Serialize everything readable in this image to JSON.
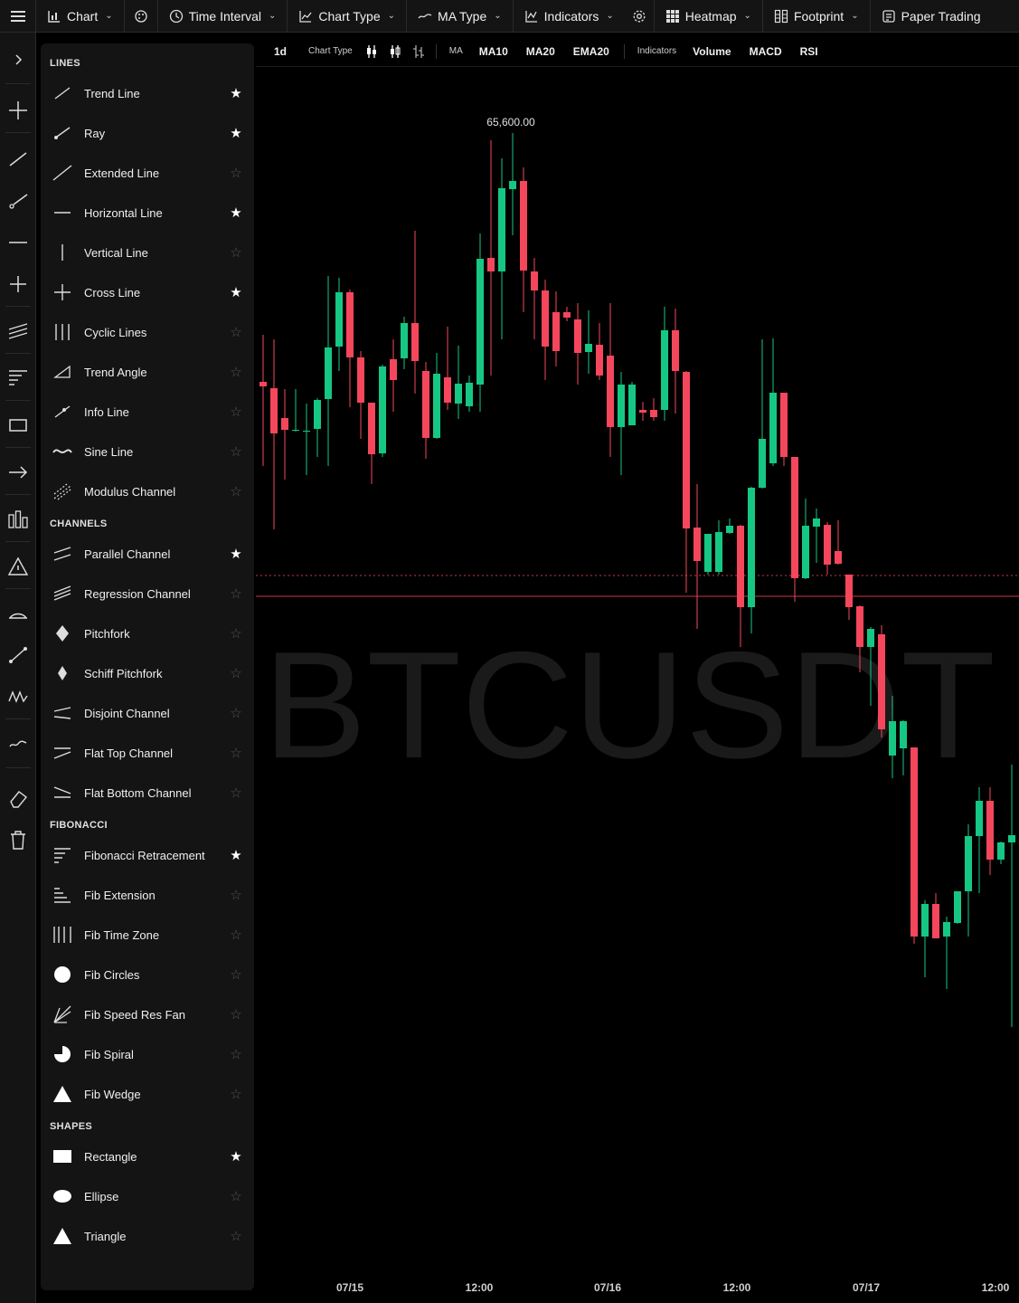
{
  "topbar": {
    "items": [
      {
        "label": "Chart",
        "icon": "bar-chart-icon",
        "dropdown": true
      },
      {
        "label": "",
        "icon": "palette-icon",
        "dropdown": false
      },
      {
        "label": "Time Interval",
        "icon": "clock-icon",
        "dropdown": true
      },
      {
        "label": "Chart Type",
        "icon": "line-chart-icon",
        "dropdown": true
      },
      {
        "label": "MA Type",
        "icon": "wave-icon",
        "dropdown": true
      },
      {
        "label": "Indicators",
        "icon": "indicators-icon",
        "dropdown": true
      },
      {
        "label": "",
        "icon": "gear-icon",
        "dropdown": false
      },
      {
        "label": "Heatmap",
        "icon": "grid-icon",
        "dropdown": true
      },
      {
        "label": "Footprint",
        "icon": "footprint-icon",
        "dropdown": true
      },
      {
        "label": "Paper Trading",
        "icon": "paper-icon",
        "dropdown": false
      }
    ]
  },
  "subbar": {
    "interval": "1d",
    "chart_type_label": "Chart Type",
    "ma_label": "MA",
    "ma_items": [
      "MA10",
      "MA20",
      "EMA20"
    ],
    "indicators_label": "Indicators",
    "indicator_items": [
      "Volume",
      "MACD",
      "RSI"
    ]
  },
  "panel": {
    "sections": [
      {
        "title": "LINES",
        "items": [
          {
            "label": "Trend Line",
            "icon": "trend-line-icon",
            "fav": true
          },
          {
            "label": "Ray",
            "icon": "ray-icon",
            "fav": true
          },
          {
            "label": "Extended Line",
            "icon": "extended-line-icon",
            "fav": false
          },
          {
            "label": "Horizontal Line",
            "icon": "horizontal-line-icon",
            "fav": true
          },
          {
            "label": "Vertical Line",
            "icon": "vertical-line-icon",
            "fav": false
          },
          {
            "label": "Cross Line",
            "icon": "cross-line-icon",
            "fav": true
          },
          {
            "label": "Cyclic Lines",
            "icon": "cyclic-lines-icon",
            "fav": false
          },
          {
            "label": "Trend Angle",
            "icon": "trend-angle-icon",
            "fav": false
          },
          {
            "label": "Info Line",
            "icon": "info-line-icon",
            "fav": false
          },
          {
            "label": "Sine Line",
            "icon": "sine-line-icon",
            "fav": false
          },
          {
            "label": "Modulus Channel",
            "icon": "modulus-channel-icon",
            "fav": false
          }
        ]
      },
      {
        "title": "CHANNELS",
        "items": [
          {
            "label": "Parallel Channel",
            "icon": "parallel-channel-icon",
            "fav": true
          },
          {
            "label": "Regression Channel",
            "icon": "regression-channel-icon",
            "fav": false
          },
          {
            "label": "Pitchfork",
            "icon": "pitchfork-icon",
            "fav": false
          },
          {
            "label": "Schiff Pitchfork",
            "icon": "schiff-pitchfork-icon",
            "fav": false
          },
          {
            "label": "Disjoint Channel",
            "icon": "disjoint-channel-icon",
            "fav": false
          },
          {
            "label": "Flat Top Channel",
            "icon": "flat-top-channel-icon",
            "fav": false
          },
          {
            "label": "Flat Bottom Channel",
            "icon": "flat-bottom-channel-icon",
            "fav": false
          }
        ]
      },
      {
        "title": "FIBONACCI",
        "items": [
          {
            "label": "Fibonacci Retracement",
            "icon": "fib-retracement-icon",
            "fav": true
          },
          {
            "label": "Fib Extension",
            "icon": "fib-extension-icon",
            "fav": false
          },
          {
            "label": "Fib Time Zone",
            "icon": "fib-time-zone-icon",
            "fav": false
          },
          {
            "label": "Fib Circles",
            "icon": "fib-circles-icon",
            "fav": false
          },
          {
            "label": "Fib Speed Res Fan",
            "icon": "fib-fan-icon",
            "fav": false
          },
          {
            "label": "Fib Spiral",
            "icon": "fib-spiral-icon",
            "fav": false
          },
          {
            "label": "Fib Wedge",
            "icon": "fib-wedge-icon",
            "fav": false
          }
        ]
      },
      {
        "title": "SHAPES",
        "items": [
          {
            "label": "Rectangle",
            "icon": "rectangle-icon",
            "fav": true
          },
          {
            "label": "Ellipse",
            "icon": "ellipse-icon",
            "fav": false
          },
          {
            "label": "Triangle",
            "icon": "triangle-icon",
            "fav": false
          }
        ]
      }
    ]
  },
  "lefttoolbar": {
    "icons": [
      "chevron-right-icon",
      "crosshair-icon",
      "trend-line-icon",
      "ray-icon",
      "horizontal-line-icon",
      "cross-line-icon",
      "channel-icon",
      "fib-icon",
      "rectangle-icon",
      "arrow-icon",
      "bars-icon",
      "triangle-alert-icon",
      "measure-icon",
      "ruler-line-icon",
      "wave-pattern-icon",
      "brush-icon",
      "eraser-icon",
      "trash-icon"
    ]
  },
  "chart": {
    "symbol_watermark": "BTCUSDT",
    "high_label": "65,600.00",
    "x_labels": [
      "07/15",
      "12:00",
      "07/16",
      "12:00",
      "07/17",
      "12:00"
    ],
    "colors": {
      "up": "#16c784",
      "down": "#f5475c",
      "background": "#000000",
      "price_line": "#f5475c"
    }
  },
  "chart_data": {
    "type": "candlestick",
    "x": [
      "07/15",
      "12:00",
      "07/16",
      "12:00",
      "07/17",
      "12:00"
    ],
    "max_high": 65600.0,
    "annotations": [
      "65,600.00"
    ]
  }
}
